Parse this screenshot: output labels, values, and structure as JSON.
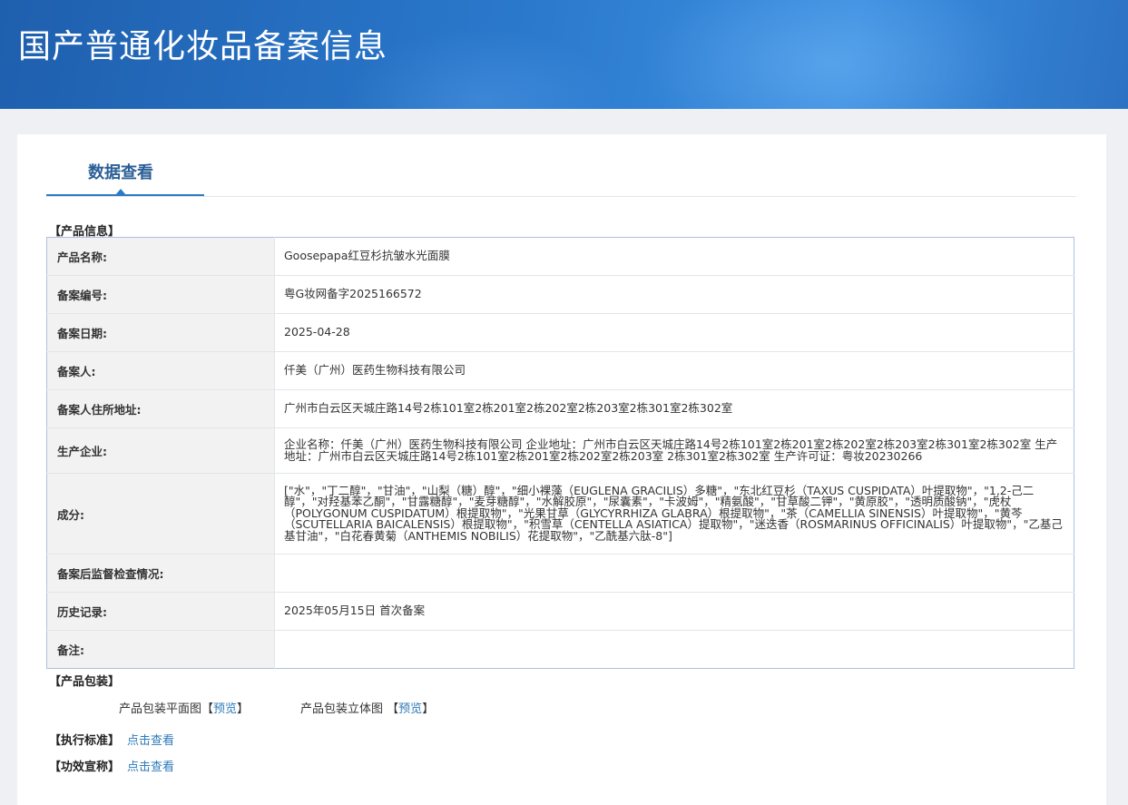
{
  "header": {
    "title": "国产普通化妆品备案信息"
  },
  "tabs": {
    "active": "数据查看"
  },
  "product_info": {
    "section_title": "【产品信息】",
    "rows": [
      {
        "label": "产品名称:",
        "value": "Goosepapa红豆杉抗皱水光面膜"
      },
      {
        "label": "备案编号:",
        "value": "粤G妆网备字2025166572"
      },
      {
        "label": "备案日期:",
        "value": "2025-04-28"
      },
      {
        "label": "备案人:",
        "value": "仟美（广州）医药生物科技有限公司"
      },
      {
        "label": "备案人住所地址:",
        "value": "广州市白云区天城庄路14号2栋101室2栋201室2栋202室2栋203室2栋301室2栋302室"
      },
      {
        "label": "生产企业:",
        "value": "企业名称：仟美（广州）医药生物科技有限公司 企业地址：广州市白云区天城庄路14号2栋101室2栋201室2栋202室2栋203室2栋301室2栋302室 生产地址：广州市白云区天城庄路14号2栋101室2栋201室2栋202室2栋203室 2栋301室2栋302室 生产许可证：粤妆20230266"
      },
      {
        "label": "成分:",
        "value": "[\"水\"，\"丁二醇\"，\"甘油\"，\"山梨（糖）醇\"，\"细小裸藻（EUGLENA GRACILIS）多糖\"，\"东北红豆杉（TAXUS CUSPIDATA）叶提取物\"，\"1,2-己二醇\"，\"对羟基苯乙酮\"，\"甘露糖醇\"，\"麦芽糖醇\"，\"水解胶原\"，\"尿囊素\"，\"卡波姆\"，\"精氨酸\"，\"甘草酸二钾\"，\"黄原胶\"，\"透明质酸钠\"，\"虎杖（POLYGONUM CUSPIDATUM）根提取物\"，\"光果甘草（GLYCYRRHIZA GLABRA）根提取物\"，\"茶（CAMELLIA SINENSIS）叶提取物\"，\"黄芩（SCUTELLARIA BAICALENSIS）根提取物\"，\"积雪草（CENTELLA ASIATICA）提取物\"，\"迷迭香（ROSMARINUS OFFICINALIS）叶提取物\"，\"乙基己基甘油\"，\"白花春黄菊（ANTHEMIS NOBILIS）花提取物\"，\"乙酰基六肽-8\"]"
      },
      {
        "label": "备案后监督检查情况:",
        "value": ""
      },
      {
        "label": "历史记录:",
        "value": "2025年05月15日 首次备案"
      },
      {
        "label": "备注:",
        "value": ""
      }
    ]
  },
  "packaging": {
    "section_title": "【产品包装】",
    "flat_label": "产品包装平面图",
    "flat_open": "【",
    "flat_link": "预览",
    "flat_close": "】",
    "solid_label": "产品包装立体图",
    "solid_open": "【",
    "solid_link": "预览",
    "solid_close": "】"
  },
  "standard": {
    "section_title": "【执行标准】",
    "link": "点击查看"
  },
  "claims": {
    "section_title": "【功效宣称】",
    "link": "点击查看"
  },
  "colors": {
    "header_blue": "#2a78cc",
    "link_blue": "#2d7ab8",
    "accent": "#2c7bc6"
  }
}
